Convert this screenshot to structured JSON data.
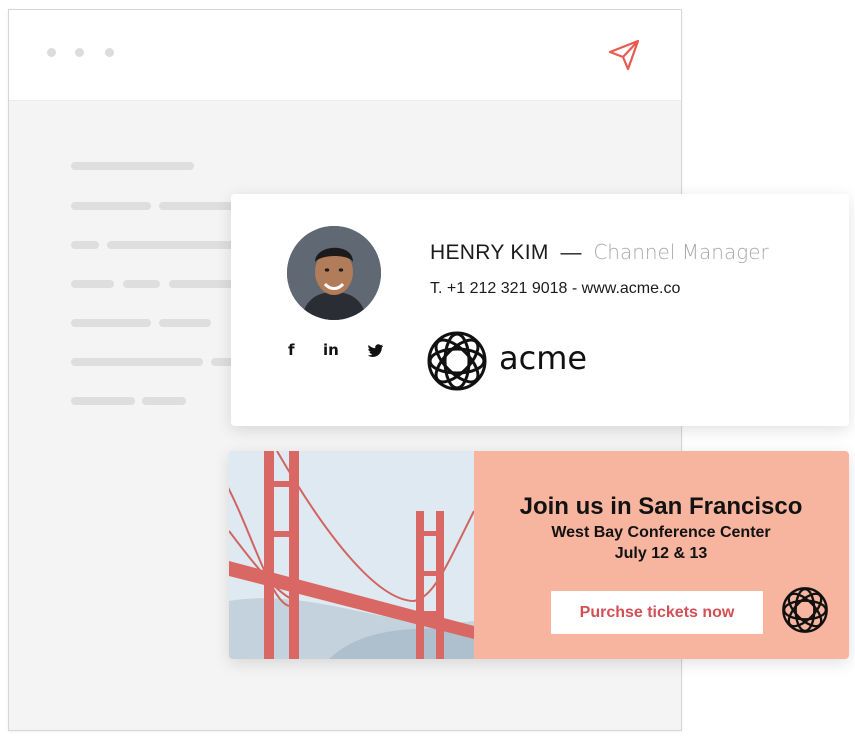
{
  "signature": {
    "name": "HENRY KIM",
    "separator": "—",
    "role": "Channel Manager",
    "contact": "T. +1 212 321 9018 - www.acme.co",
    "social": {
      "facebook": "f",
      "linkedin": "in",
      "twitter": "twitter-icon"
    },
    "company": "acme"
  },
  "banner": {
    "title": "Join us in San Francisco",
    "venue": "West Bay Conference Center",
    "date": "July 12 & 13",
    "cta_label": "Purchse tickets now"
  },
  "colors": {
    "accent": "#e85a4f",
    "banner_bg": "#f7b49e",
    "cta_text": "#d24f56",
    "window_bg": "#f4f4f4"
  }
}
